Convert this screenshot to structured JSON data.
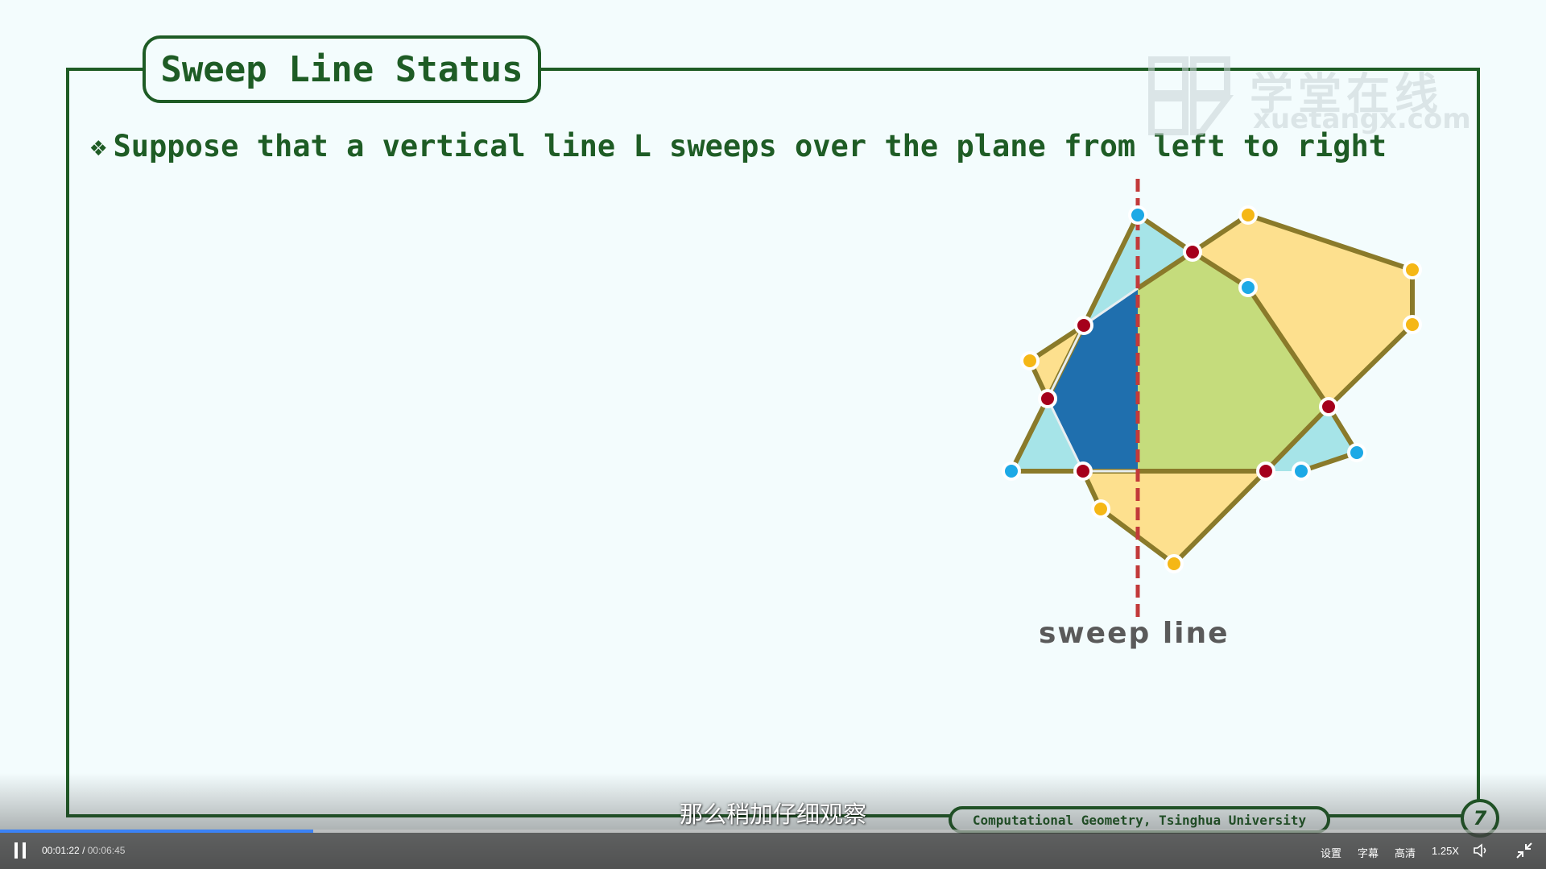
{
  "slide": {
    "title": "Sweep Line Status",
    "bullet_icon": "diamond-bullet-icon",
    "bullet_text": "Suppose that a vertical line L sweeps over the plane from left to right",
    "diagram_label": "sweep line",
    "footer": "Computational Geometry, Tsinghua University",
    "page_number": "7",
    "watermark": {
      "cn": "学堂在线",
      "url": "xuetangx.com"
    },
    "colors": {
      "frame": "#1e5c25",
      "cyan_region": "#a6e4e8",
      "yellow_region": "#fde08e",
      "green_region": "#c5dc7c",
      "blue_region": "#1f6fae",
      "edge": "#8a7a2a",
      "sweep_line": "#c23a3a",
      "point_red": "#a5001b",
      "point_blue": "#1da9e6",
      "point_yellow": "#f5b716"
    }
  },
  "subtitle": "那么稍加仔细观察",
  "player": {
    "current_time": "00:01:22",
    "separator": "/",
    "total_time": "00:06:45",
    "progress": 0.2025,
    "settings_label": "设置",
    "captions_label": "字幕",
    "quality_label": "高清",
    "speed_label": "1.25X",
    "volume_icon": "volume-icon",
    "exit_fullscreen_icon": "exit-fullscreen-icon",
    "pause_icon": "pause-icon"
  }
}
